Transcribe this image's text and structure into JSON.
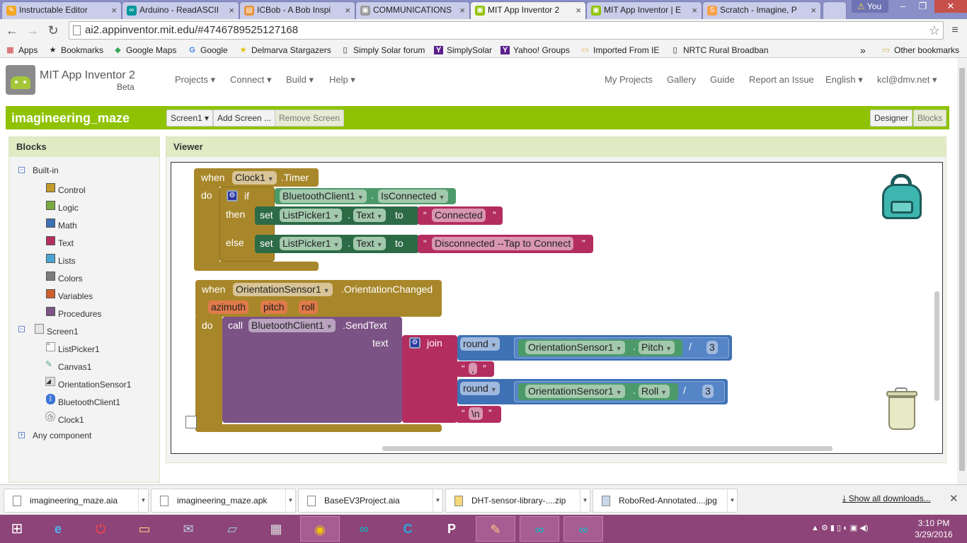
{
  "browser": {
    "tabs": [
      {
        "title": "Instructable Editor",
        "icon_color": "#f5a623"
      },
      {
        "title": "Arduino - ReadASCII",
        "icon_color": "#00979c"
      },
      {
        "title": "ICBob - A Bob Inspi",
        "icon_color": "#e8923b"
      },
      {
        "title": "COMMUNICATIONS",
        "icon_color": "#999999"
      },
      {
        "title": "MIT App Inventor 2",
        "icon_color": "#8fc202"
      },
      {
        "title": "MIT App Inventor | E",
        "icon_color": "#8fc202"
      },
      {
        "title": "Scratch - Imagine, P",
        "icon_color": "#f7a14a"
      }
    ],
    "user_badge": "You",
    "url": "ai2.appinventor.mit.edu/#4746789525127168",
    "bookmarks": [
      {
        "label": "Apps",
        "icon": "apps-grid-icon"
      },
      {
        "label": "Bookmarks",
        "icon": "star-icon"
      },
      {
        "label": "Google Maps",
        "icon": "maps-icon"
      },
      {
        "label": "Google",
        "icon": "google-icon"
      },
      {
        "label": "Delmarva Stargazers",
        "icon": "star-icon"
      },
      {
        "label": "Simply Solar forum",
        "icon": "page-icon"
      },
      {
        "label": "SimplySolar",
        "icon": "yahoo-icon"
      },
      {
        "label": "Yahoo! Groups",
        "icon": "yahoo-icon"
      },
      {
        "label": "Imported From IE",
        "icon": "folder-icon"
      },
      {
        "label": "NRTC Rural Broadban",
        "icon": "page-icon"
      }
    ],
    "other_bookmarks": "Other bookmarks",
    "overflow": "»"
  },
  "app": {
    "name": "MIT App Inventor 2",
    "beta": "Beta",
    "menus": [
      "Projects ▾",
      "Connect ▾",
      "Build ▾",
      "Help ▾"
    ],
    "right_links": [
      "My Projects",
      "Gallery",
      "Guide",
      "Report an Issue",
      "English ▾",
      "kcl@dmv.net ▾"
    ],
    "project_name": "imagineering_maze",
    "screen_select": "Screen1 ▾",
    "add_screen": "Add Screen ...",
    "remove_screen": "Remove Screen",
    "designer": "Designer",
    "blocks": "Blocks"
  },
  "blocks_panel": {
    "title": "Blocks",
    "builtin": "Built-in",
    "categories": [
      {
        "label": "Control",
        "color": "#c39a2c"
      },
      {
        "label": "Logic",
        "color": "#77ab41"
      },
      {
        "label": "Math",
        "color": "#3f71b5"
      },
      {
        "label": "Text",
        "color": "#b32d5e"
      },
      {
        "label": "Lists",
        "color": "#49a6d4"
      },
      {
        "label": "Colors",
        "color": "#7d7d7d"
      },
      {
        "label": "Variables",
        "color": "#d05f2d"
      },
      {
        "label": "Procedures",
        "color": "#7c5385"
      }
    ],
    "screen": "Screen1",
    "components": [
      "ListPicker1",
      "Canvas1",
      "OrientationSensor1",
      "BluetoothClient1",
      "Clock1"
    ],
    "any_component": "Any component"
  },
  "viewer": {
    "title": "Viewer",
    "timer_block": {
      "when": "when",
      "component": "Clock1",
      "event": ".Timer",
      "do": "do",
      "if": "if",
      "then": "then",
      "else": "else",
      "condition_component": "BluetoothClient1",
      "condition_prop": "IsConnected",
      "set": "set",
      "to": "to",
      "target": "ListPicker1",
      "prop": "Text",
      "then_text": "Connected",
      "else_text": "Disconnected --Tap to Connect"
    },
    "orientation_block": {
      "when": "when",
      "component": "OrientationSensor1",
      "event": ".OrientationChanged",
      "params": [
        "azimuth",
        "pitch",
        "roll"
      ],
      "do": "do",
      "call": "call",
      "call_component": "BluetoothClient1",
      "method": ".SendText",
      "text": "text",
      "join": "join",
      "round": "round",
      "sensor": "OrientationSensor1",
      "pitch_prop": "Pitch",
      "roll_prop": "Roll",
      "divide": "/",
      "divisor": "3",
      "comma": ",",
      "newline": "\\n"
    }
  },
  "downloads": {
    "items": [
      "imagineering_maze.aia",
      "imagineering_maze.apk",
      "BaseEV3Project.aia",
      "DHT-sensor-library-....zip",
      "RoboRed-Annotated....jpg"
    ],
    "show_all": "Show all downloads..."
  },
  "taskbar": {
    "time": "3:10 PM",
    "date": "3/29/2016"
  }
}
